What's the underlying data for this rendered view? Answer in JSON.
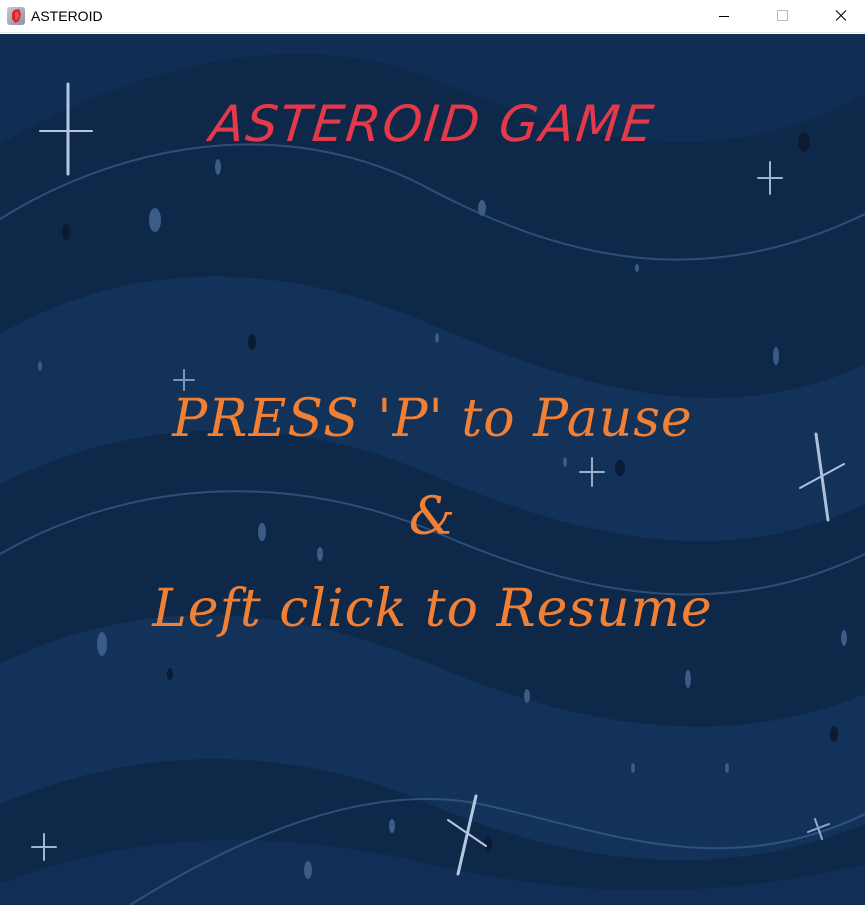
{
  "window": {
    "title": "ASTEROID",
    "icon": "asteroid-app-icon",
    "controls": [
      "minimize-icon",
      "maximize-icon",
      "close-icon"
    ]
  },
  "game": {
    "title": "ASTEROID GAME",
    "instructions": {
      "pause": "PRESS 'P' to Pause",
      "joiner": "&",
      "resume": "Left click to Resume"
    }
  },
  "colors": {
    "background": "#0e2849",
    "wave": "#14345c",
    "wave_line": "#3a5f8c",
    "title": "#e3394a",
    "instructions": "#f28034"
  }
}
